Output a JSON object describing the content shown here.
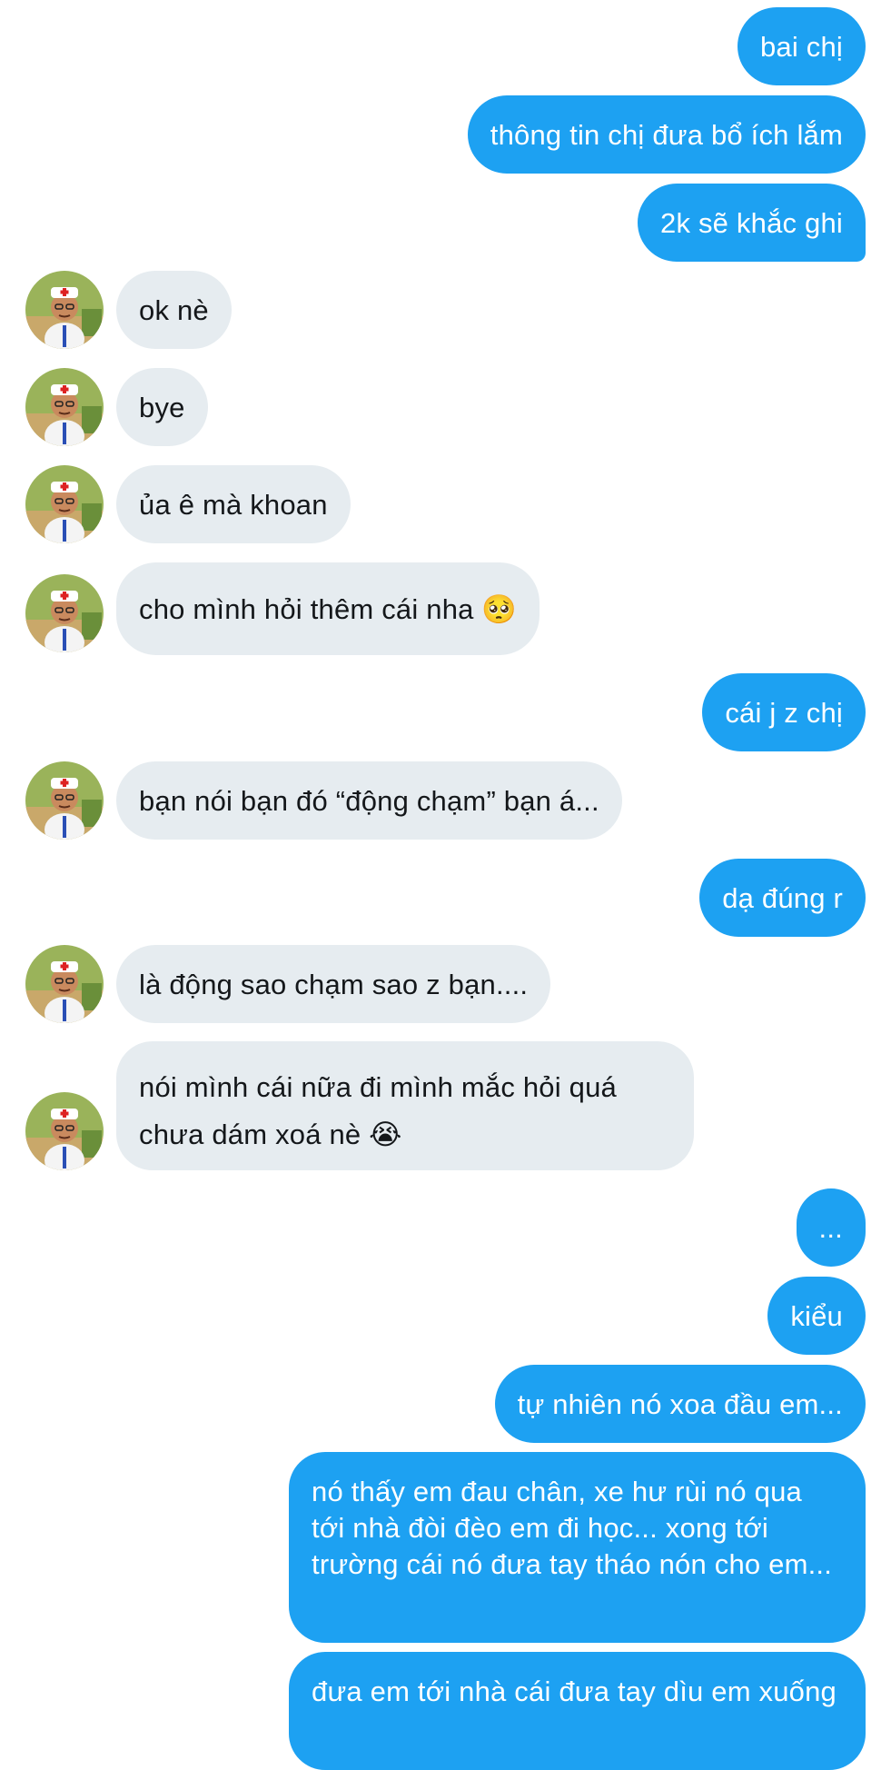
{
  "colors": {
    "outgoing_bubble": "#1da1f2",
    "incoming_bubble": "#e6ecf0",
    "outgoing_text": "#ffffff",
    "incoming_text": "#14171a"
  },
  "messages": [
    {
      "side": "me",
      "text": "bai chị"
    },
    {
      "side": "me",
      "text": "thông tin chị đưa bổ ích lắm"
    },
    {
      "side": "me",
      "text": "2k sẽ khắc ghi"
    },
    {
      "side": "them",
      "text": "ok nè"
    },
    {
      "side": "them",
      "text": "bye"
    },
    {
      "side": "them",
      "text": "ủa ê mà khoan"
    },
    {
      "side": "them",
      "text": "cho mình hỏi thêm cái nha 🥺"
    },
    {
      "side": "me",
      "text": "cái j z chị"
    },
    {
      "side": "them",
      "text": "bạn nói bạn đó “động chạm” bạn á..."
    },
    {
      "side": "me",
      "text": "dạ đúng r"
    },
    {
      "side": "them",
      "text": "là động sao chạm sao z bạn...."
    },
    {
      "side": "them",
      "text": "nói mình cái nữa đi mình mắc hỏi quá chưa dám xoá nè 😭"
    },
    {
      "side": "me",
      "text": "..."
    },
    {
      "side": "me",
      "text": "kiểu"
    },
    {
      "side": "me",
      "text": "tự nhiên nó xoa đầu em..."
    },
    {
      "side": "me",
      "text": "nó thấy em đau chân, xe hư rùi nó qua tới nhà đòi đèo em đi học... xong tới trường cái nó đưa tay tháo nón cho em..."
    },
    {
      "side": "me",
      "text": "đưa em tới nhà cái đưa tay dìu em xuống"
    }
  ],
  "avatar_icon": "doctor-avatar-icon"
}
